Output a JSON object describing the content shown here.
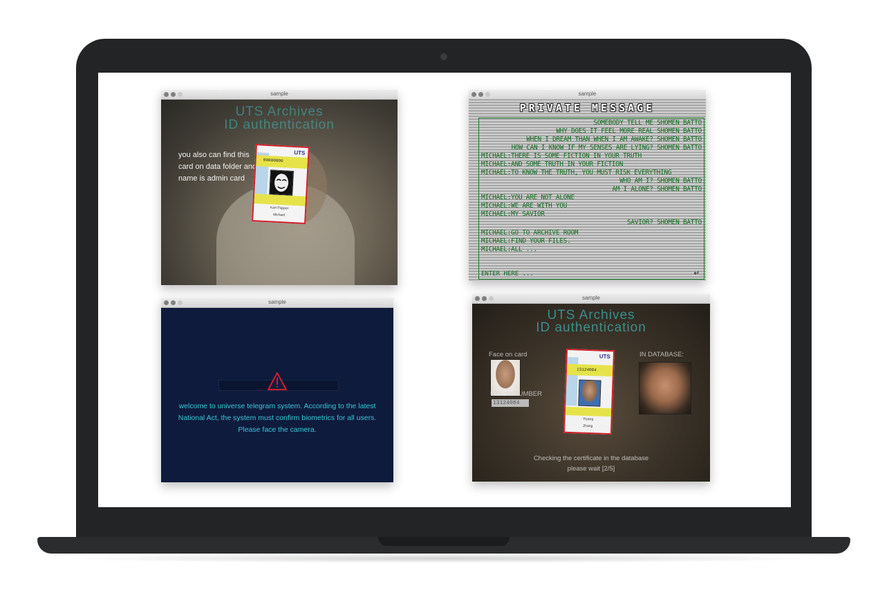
{
  "windows": [
    {
      "title": "sample",
      "heading_line1": "UTS Archives",
      "heading_line2": "ID authentication",
      "hint": "you also can find this card on data folder and name is admin card",
      "card": {
        "logo": "UTS",
        "id_number": "00000000",
        "name1": "Karl Popper",
        "name2": "Michael"
      }
    },
    {
      "title": "sample",
      "heading": "PRIVATE MESSAGE",
      "lines": [
        {
          "text": "SOMEBODY TELL ME  SHOMEN BATTO",
          "align": "right"
        },
        {
          "text": "WHY DOES IT FEEL MORE REAL  SHOMEN BATTO",
          "align": "right"
        },
        {
          "text": "WHEN I DREAM THAN WHEN I AM AWAKE?  SHOMEN BATTO",
          "align": "right"
        },
        {
          "text": "HOW CAN I KNOW IF MY SENSES ARE LYING?  SHOMEN BATTO",
          "align": "right"
        },
        {
          "text": "MICHAEL:THERE IS SOME FICTION IN YOUR TRUTH",
          "align": "left"
        },
        {
          "text": "MICHAEL:AND SOME TRUTH IN YOUR FICTION",
          "align": "left"
        },
        {
          "text": "MICHAEL:TO KNOW THE TRUTH, YOU MUST RISK EVERYTHING",
          "align": "left"
        },
        {
          "text": "WHO AM I?  SHOMEN BATTO",
          "align": "right"
        },
        {
          "text": "AM I ALONE?  SHOMEN BATTO",
          "align": "right"
        },
        {
          "text": "MICHAEL:YOU ARE NOT ALONE",
          "align": "left"
        },
        {
          "text": "MICHAEL:WE ARE WITH YOU",
          "align": "left"
        },
        {
          "text": "MICHAEL:MY SAVIOR",
          "align": "left"
        },
        {
          "text": "SAVIOR?  SHOMEN BATTO",
          "align": "right"
        },
        {
          "text": "MICHAEL:GO TO ARCHIVE ROOM",
          "align": "left"
        },
        {
          "text": "MICHAEL:FIND YOUR FILES.",
          "align": "left"
        },
        {
          "text": "MICHAEL:ALL ...",
          "align": "left"
        }
      ],
      "input_placeholder": "ENTER HERE ...",
      "enter_symbol": "↵"
    },
    {
      "title": "sample",
      "message": "welcome to universe telegram system. According to the latest National Act, the system must confirm biometrics for all users. Please face the camera.",
      "warning_color": "#d0202a"
    },
    {
      "title": "sample",
      "heading_line1": "UTS Archives",
      "heading_line2": "ID authentication",
      "face_on_card_label": "Face on card",
      "in_database_label": "IN DATABASE:",
      "id_label": "UTS ID NUMBER",
      "id_value": "13124084",
      "card": {
        "logo": "UTS",
        "id_number": "13124084",
        "name1": "Yiyang",
        "name2": "Zhang"
      },
      "status_line1": "Checking the certificate in the database",
      "status_line2": "please wait [2/5]"
    }
  ],
  "colors": {
    "accent_cyan": "#3fb7b9",
    "terminal_green": "#0f6a1b",
    "card_border": "#d0202a"
  }
}
